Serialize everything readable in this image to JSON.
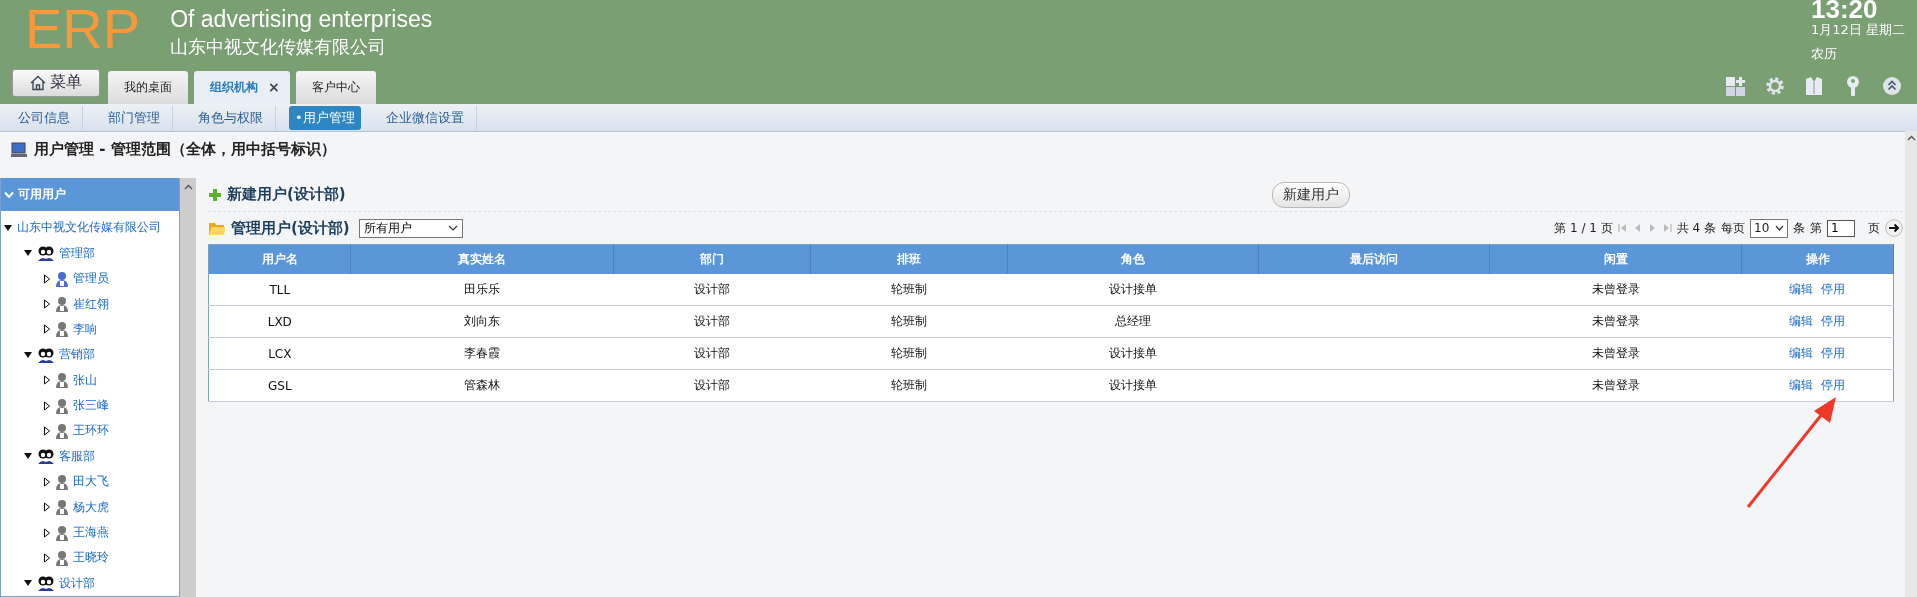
{
  "header": {
    "logo": "ERP",
    "subtitle": "Of advertising enterprises",
    "company": "山东中视文化传媒有限公司",
    "clock": {
      "time": "13:20",
      "date": "1月12日 星期二",
      "lunar": "农历"
    }
  },
  "menu_button": "菜单",
  "tabs": [
    {
      "label": "我的桌面",
      "selected": false
    },
    {
      "label": "组织机构",
      "selected": true,
      "close": "×"
    },
    {
      "label": "客户中心",
      "selected": false
    }
  ],
  "subnav": [
    {
      "label": "公司信息",
      "selected": false
    },
    {
      "label": "部门管理",
      "selected": false
    },
    {
      "label": "角色与权限",
      "selected": false
    },
    {
      "label": "•用户管理",
      "selected": true
    },
    {
      "label": "企业微信设置",
      "selected": false
    }
  ],
  "page_title": "用户管理 - 管理范围（全体，用中括号标识）",
  "sidebar": {
    "title": "可用用户",
    "tree": [
      {
        "label": "山东中视文化传媒有限公司",
        "expanded": true,
        "children": [
          {
            "label": "管理部",
            "kind": "department",
            "expanded": true,
            "children": [
              {
                "label": "管理员",
                "kind": "admin",
                "expanded": false
              },
              {
                "label": "崔红翎",
                "kind": "user",
                "expanded": false
              },
              {
                "label": "李响",
                "kind": "user",
                "expanded": false
              }
            ]
          },
          {
            "label": "营销部",
            "kind": "department",
            "expanded": true,
            "children": [
              {
                "label": "张山",
                "kind": "user",
                "expanded": false
              },
              {
                "label": "张三峰",
                "kind": "user",
                "expanded": false
              },
              {
                "label": "王环环",
                "kind": "user",
                "expanded": false
              }
            ]
          },
          {
            "label": "客服部",
            "kind": "department",
            "expanded": true,
            "children": [
              {
                "label": "田大飞",
                "kind": "user",
                "expanded": false
              },
              {
                "label": "杨大虎",
                "kind": "user",
                "expanded": false
              },
              {
                "label": "王海燕",
                "kind": "user",
                "expanded": false
              },
              {
                "label": "王晓玲",
                "kind": "user",
                "expanded": false
              }
            ]
          },
          {
            "label": "设计部",
            "kind": "department",
            "expanded": true
          }
        ]
      }
    ]
  },
  "new_user": {
    "heading": "新建用户(设计部)",
    "button": "新建用户"
  },
  "manage": {
    "heading": "管理用户(设计部)",
    "filter": "所有用户"
  },
  "pager": {
    "page": "第 1 / 1 页",
    "total": "共 4 条",
    "per_page_label": "每页",
    "per_page": "10",
    "unit": "条",
    "goto_label": "第",
    "goto_value": "1",
    "goto_unit": "页"
  },
  "table": {
    "columns": [
      "用户名",
      "真实姓名",
      "部门",
      "排班",
      "角色",
      "最后访问",
      "闲置",
      "操作"
    ],
    "rows": [
      {
        "cells": [
          "TLL",
          "田乐乐",
          "设计部",
          "轮班制",
          "设计接单",
          "",
          "未曾登录"
        ],
        "actions": [
          "编辑",
          "停用"
        ]
      },
      {
        "cells": [
          "LXD",
          "刘向东",
          "设计部",
          "轮班制",
          "总经理",
          "",
          "未曾登录"
        ],
        "actions": [
          "编辑",
          "停用"
        ]
      },
      {
        "cells": [
          "LCX",
          "李春霞",
          "设计部",
          "轮班制",
          "设计接单",
          "",
          "未曾登录"
        ],
        "actions": [
          "编辑",
          "停用"
        ]
      },
      {
        "cells": [
          "GSL",
          "管森林",
          "设计部",
          "轮班制",
          "设计接单",
          "",
          "未曾登录"
        ],
        "actions": [
          "编辑",
          "停用"
        ]
      }
    ]
  }
}
